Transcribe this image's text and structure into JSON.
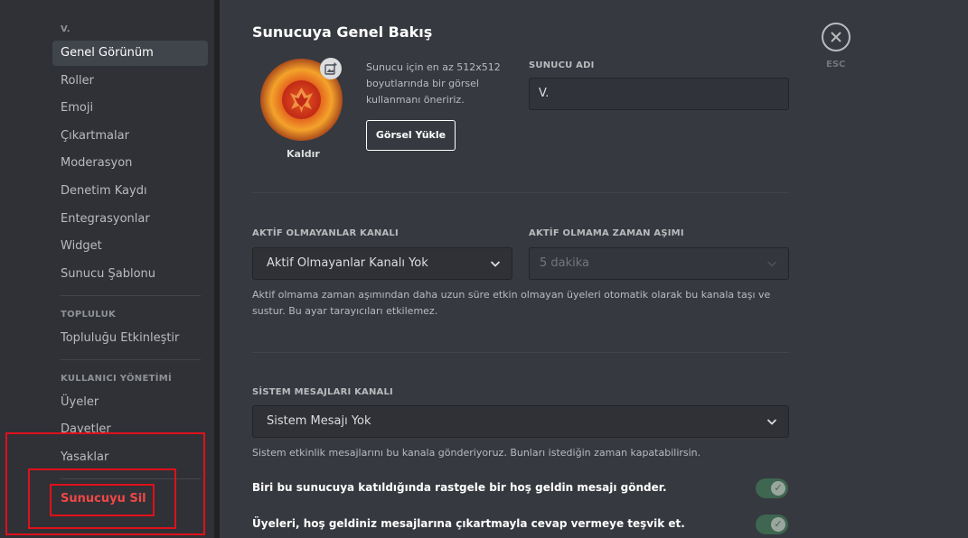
{
  "sidebar": {
    "server_header": "V.",
    "server_items": [
      {
        "label": "Genel Görünüm"
      },
      {
        "label": "Roller"
      },
      {
        "label": "Emoji"
      },
      {
        "label": "Çıkartmalar"
      },
      {
        "label": "Moderasyon"
      },
      {
        "label": "Denetim Kaydı"
      },
      {
        "label": "Entegrasyonlar"
      },
      {
        "label": "Widget"
      },
      {
        "label": "Sunucu Şablonu"
      }
    ],
    "community_header": "TOPLULUK",
    "community_items": [
      {
        "label": "Topluluğu Etkinleştir"
      }
    ],
    "user_mgmt_header": "KULLANICI YÖNETİMİ",
    "user_mgmt_items": [
      {
        "label": "Üyeler"
      },
      {
        "label": "Davetler"
      },
      {
        "label": "Yasaklar"
      }
    ],
    "delete_server": "Sunucuyu Sil"
  },
  "main": {
    "title": "Sunucuya Genel Bakış",
    "icon": {
      "remove_label": "Kaldır",
      "upload_hint": "Sunucu için en az 512x512 boyutlarında bir görsel kullanmanı öneririz.",
      "upload_button": "Görsel Yükle"
    },
    "server_name": {
      "label": "SUNUCU ADI",
      "value": "V."
    },
    "afk_channel": {
      "label": "AKTİF OLMAYANLAR KANALI",
      "value": "Aktif Olmayanlar Kanalı Yok"
    },
    "afk_timeout": {
      "label": "AKTİF OLMAMA ZAMAN AŞIMI",
      "value": "5 dakika"
    },
    "afk_help": "Aktif olmama zaman aşımından daha uzun süre etkin olmayan üyeleri otomatik olarak bu kanala taşı ve sustur. Bu ayar tarayıcıları etkilemez.",
    "system_channel": {
      "label": "SİSTEM MESAJLARI KANALI",
      "value": "Sistem Mesajı Yok"
    },
    "system_help": "Sistem etkinlik mesajlarını bu kanala gönderiyoruz. Bunları istediğin zaman kapatabilirsin.",
    "toggles": [
      {
        "label": "Biri bu sunucuya katıldığında rastgele bir hoş geldin mesajı gönder.",
        "on": true
      },
      {
        "label": "Üyeleri, hoş geldiniz mesajlarına çıkartmayla cevap vermeye teşvik et.",
        "on": true
      }
    ]
  },
  "close": {
    "esc_label": "ESC"
  },
  "colors": {
    "accent_danger": "#f04747",
    "toggle_on": "#3e6650",
    "highlight_box": "#e0101a"
  }
}
